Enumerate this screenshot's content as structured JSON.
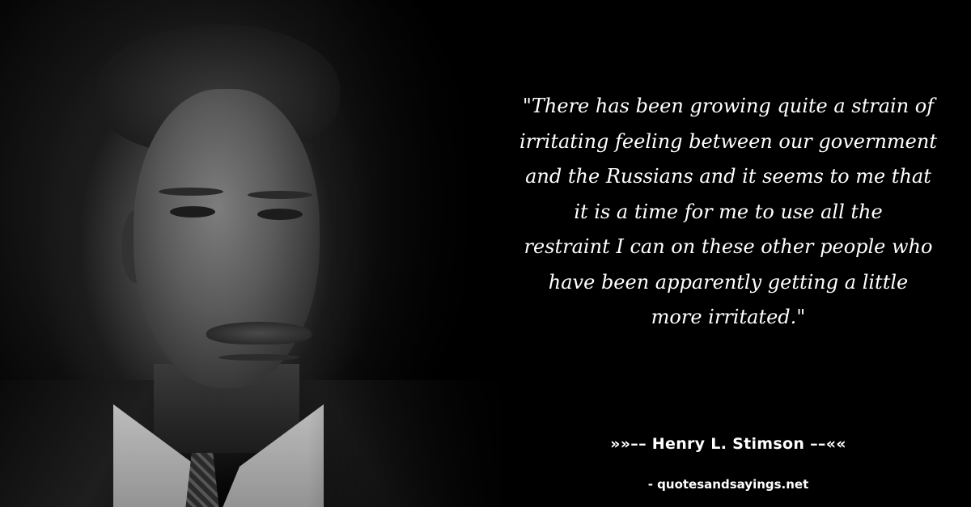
{
  "quote": {
    "lines": [
      "\"There has been growing quite a strain of",
      "irritating feeling between our government",
      "and the Russians and it seems to me that",
      "it is a time for me to use all the",
      "restraint I can on these other people who",
      "have been apparently getting a little",
      "more irritated.\""
    ]
  },
  "author": "»»–– Henry L. Stimson ––««",
  "source": "- quotesandsayings.net",
  "colors": {
    "background": "#000000",
    "text": "#ffffff"
  }
}
